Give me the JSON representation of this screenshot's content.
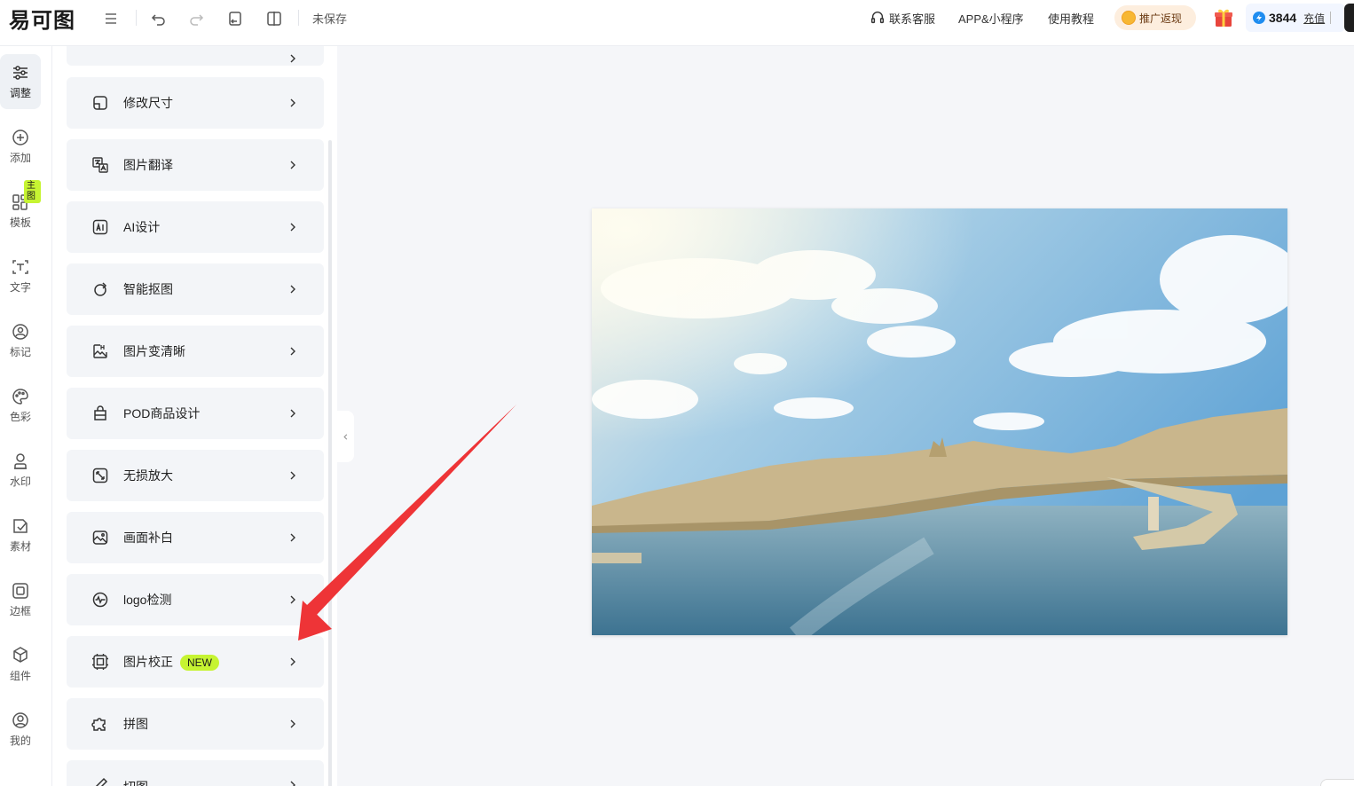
{
  "header": {
    "logo_text": "易可图",
    "save_status": "未保存",
    "support_label": "联系客服",
    "app_label": "APP&小程序",
    "tutorial_label": "使用教程",
    "promo_label": "推广返现",
    "credits": "3844",
    "recharge_label": "充值"
  },
  "nav": [
    {
      "label": "调整",
      "icon": "sliders-icon",
      "active": true
    },
    {
      "label": "添加",
      "icon": "plus-circle-icon"
    },
    {
      "label": "模板",
      "icon": "template-grid-icon",
      "badge": "主图"
    },
    {
      "label": "文字",
      "icon": "text-icon"
    },
    {
      "label": "标记",
      "icon": "marker-icon"
    },
    {
      "label": "色彩",
      "icon": "palette-icon"
    },
    {
      "label": "水印",
      "icon": "watermark-icon"
    },
    {
      "label": "素材",
      "icon": "material-icon"
    },
    {
      "label": "边框",
      "icon": "frame-icon"
    },
    {
      "label": "组件",
      "icon": "component-icon"
    },
    {
      "label": "我的",
      "icon": "user-icon"
    }
  ],
  "tools": [
    {
      "label": "修改尺寸",
      "icon": "resize-icon"
    },
    {
      "label": "图片翻译",
      "icon": "translate-icon"
    },
    {
      "label": "AI设计",
      "icon": "ai-icon"
    },
    {
      "label": "智能抠图",
      "icon": "cutout-icon"
    },
    {
      "label": "图片变清晰",
      "icon": "hd-icon"
    },
    {
      "label": "POD商品设计",
      "icon": "bag-icon"
    },
    {
      "label": "无损放大",
      "icon": "expand-icon"
    },
    {
      "label": "画面补白",
      "icon": "fill-icon"
    },
    {
      "label": "logo检测",
      "icon": "logo-detect-icon"
    },
    {
      "label": "图片校正",
      "icon": "correct-icon",
      "badge": "NEW"
    },
    {
      "label": "拼图",
      "icon": "puzzle-icon"
    },
    {
      "label": "切图",
      "icon": "cut-icon"
    }
  ],
  "colors": {
    "accent_badge": "#c6f432",
    "arrow": "#ee3437",
    "canvas_bg": "#f5f6f9",
    "credit_blue": "#1f8df0"
  }
}
